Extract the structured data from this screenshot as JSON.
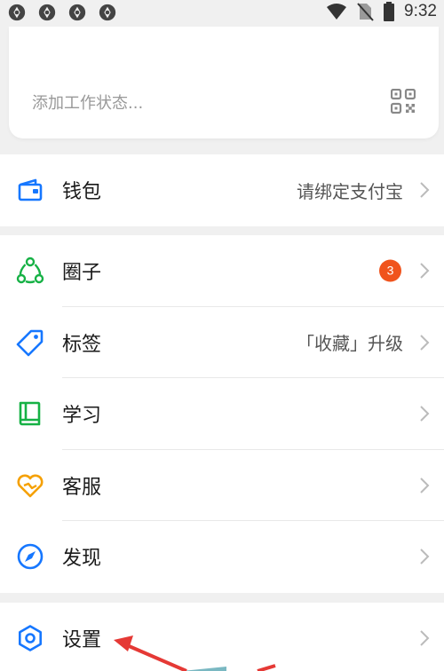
{
  "status_bar": {
    "time": "9:32",
    "left_icons": [
      "app-notification-icon",
      "app-notification-icon",
      "app-notification-icon",
      "app-notification-icon"
    ],
    "right_icons": [
      "wifi-icon",
      "no-sim-icon",
      "battery-icon"
    ]
  },
  "profile": {
    "work_status_placeholder": "添加工作状态...",
    "qr_icon": "qr-code-icon"
  },
  "menu": {
    "wallet": {
      "label": "钱包",
      "value": "请绑定支付宝",
      "icon": "wallet-icon",
      "color": "#1677ff"
    },
    "circle": {
      "label": "圈子",
      "badge": "3",
      "icon": "circle-group-icon",
      "color": "#16b145"
    },
    "tags": {
      "label": "标签",
      "value": "「收藏」升级",
      "icon": "tag-icon",
      "color": "#1677ff"
    },
    "study": {
      "label": "学习",
      "icon": "book-icon",
      "color": "#16b145"
    },
    "service": {
      "label": "客服",
      "icon": "customer-service-icon",
      "color": "#f5a000"
    },
    "discover": {
      "label": "发现",
      "icon": "compass-icon",
      "color": "#1677ff"
    },
    "settings": {
      "label": "设置",
      "icon": "gear-icon",
      "color": "#1677ff"
    }
  },
  "colors": {
    "badge": "#f0531c",
    "annotation_arrow": "#e53935",
    "background": "#f0f0f0"
  }
}
